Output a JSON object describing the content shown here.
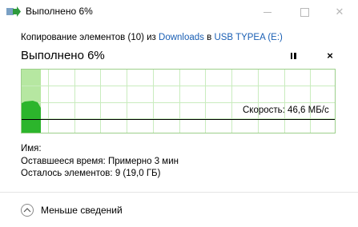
{
  "window": {
    "title": "Выполнено 6%",
    "close_glyph": "✕"
  },
  "copy": {
    "prefix": "Копирование элементов (10) из ",
    "source": "Downloads",
    "mid": " в ",
    "destination": "USB TYPEA (E:)"
  },
  "progress": {
    "title": "Выполнено 6%",
    "percent": 6,
    "close_glyph": "×"
  },
  "graph": {
    "speed_label": "Скорость: 46,6 МБ/с",
    "accent": "#2cb52c",
    "done_fill": "#b6e7a1"
  },
  "details": {
    "name_label": "Имя:",
    "time_label": "Оставшееся время:",
    "time_value": "Примерно 3 мин",
    "items_label": "Осталось элементов:",
    "items_value": "9 (19,0 ГБ)"
  },
  "footer": {
    "less_details": "Меньше сведений"
  },
  "icons": {
    "app": "copy-arrow-icon",
    "pause": "pause-icon",
    "close": "close-icon",
    "chevron": "chevron-up-icon"
  }
}
